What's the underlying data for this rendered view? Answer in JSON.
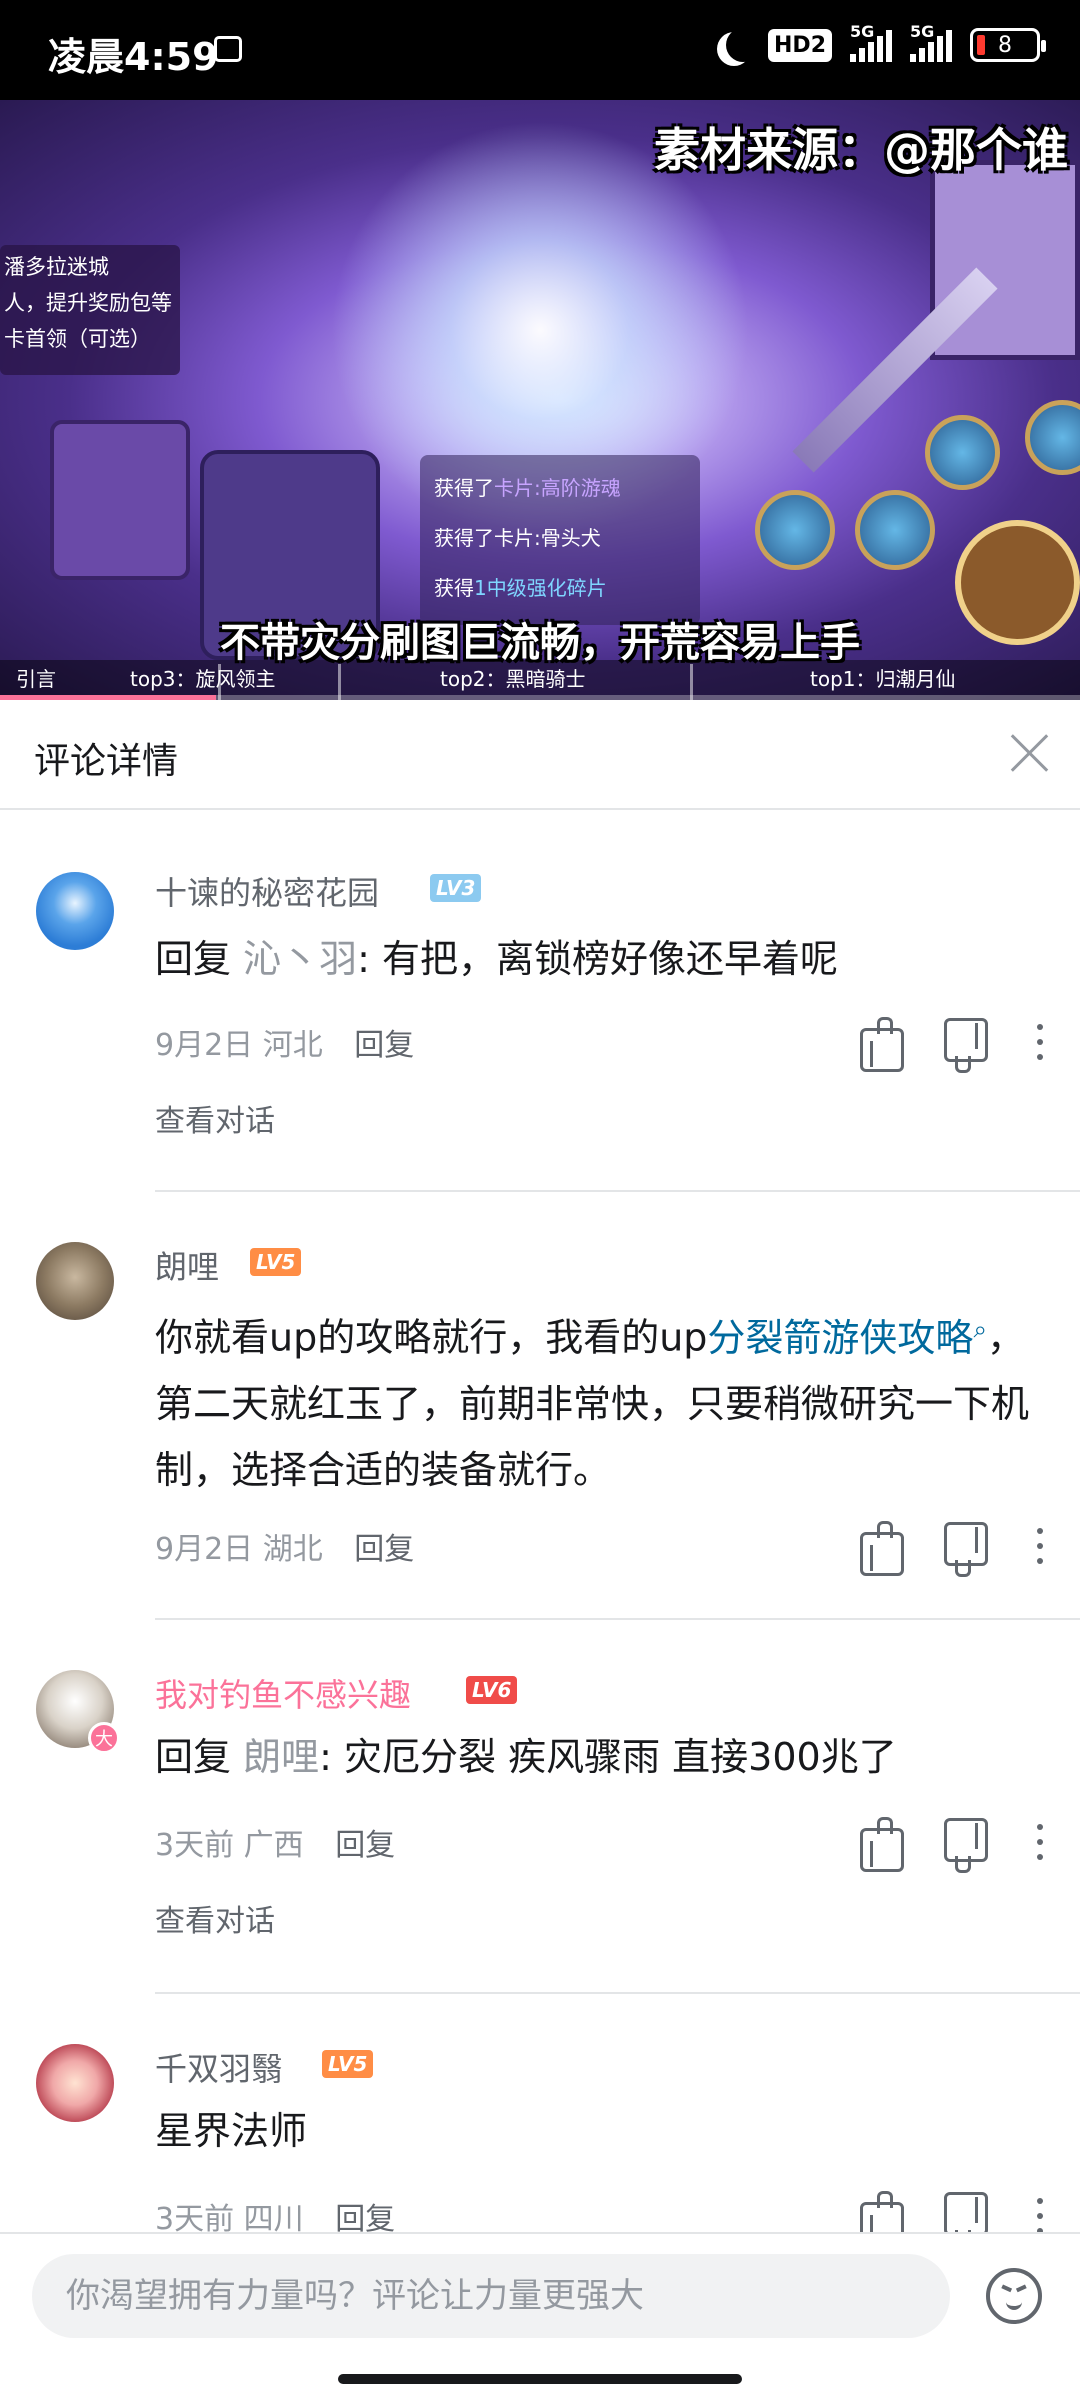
{
  "status_bar": {
    "time": "凌晨4:59",
    "hd_label": "HD2",
    "network_1": "5G",
    "network_2": "5G",
    "battery": "8"
  },
  "video": {
    "source_overlay": "素材来源：@那个谁",
    "subtitle": "不带灾分刷图巨流畅，开荒容易上手",
    "hud": {
      "dungeon_name": "潘多拉迷城",
      "line2": "人，提升奖励包等",
      "line3": "卡首领（可选）"
    },
    "loot": [
      "获得了",
      "卡片:高阶游魂",
      "获得了卡片:骨头犬",
      "获得",
      "1中级强化碎片"
    ],
    "chapters": [
      "引言",
      "top3：旋风领主",
      "top2：黑暗骑士",
      "top1：归潮月仙"
    ],
    "progress_fraction": 0.2
  },
  "panel": {
    "title": "评论详情"
  },
  "comments": [
    {
      "username": "十谏的秘密花园",
      "level": "LV3",
      "reply_prefix": "回复",
      "reply_to": "沁丶羽",
      "text": ": 有把，离锁榜好像还早着呢",
      "date": "9月2日",
      "location": "河北",
      "reply_label": "回复",
      "view_conversation": "查看对话"
    },
    {
      "username": "朗哩",
      "level": "LV5",
      "text_before": "你就看up的攻略就行，我看的up",
      "link": "分裂箭游侠攻略",
      "text_after": "，第二天就红玉了，前期非常快，只要稍微研究一下机制，选择合适的装备就行。",
      "date": "9月2日",
      "location": "湖北",
      "reply_label": "回复"
    },
    {
      "username": "我对钓鱼不感兴趣",
      "level": "LV6",
      "avatar_badge": "大",
      "reply_prefix": "回复",
      "reply_to": "朗哩",
      "text": ": 灾厄分裂  疾风骤雨  直接300兆了",
      "date": "3天前",
      "location": "广西",
      "reply_label": "回复",
      "view_conversation": "查看对话"
    },
    {
      "username": "千双羽翳",
      "level": "LV5",
      "text": "星界法师",
      "date": "3天前",
      "location": "四川",
      "reply_label": "回复"
    }
  ],
  "comment_input": {
    "placeholder": "你渴望拥有力量吗？评论让力量更强大"
  },
  "colors": {
    "accent_pink": "#fb7299",
    "link_blue": "#00699d",
    "lv3": "#8ccaf0",
    "lv5": "#ff8d45",
    "lv6": "#f04c49"
  }
}
